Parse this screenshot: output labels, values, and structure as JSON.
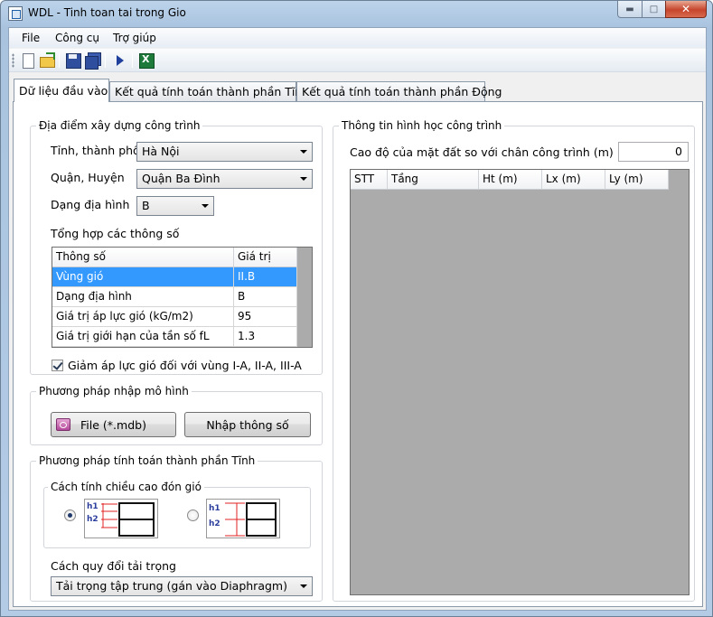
{
  "window": {
    "title": "WDL - Tinh toan tai trong Gio"
  },
  "menu": [
    {
      "label": "File"
    },
    {
      "label": "Công cụ"
    },
    {
      "label": "Trợ giúp"
    }
  ],
  "toolbar": {
    "icons": [
      "new-file-icon",
      "open-folder-icon",
      "save-icon",
      "save-all-icon",
      "run-icon",
      "excel-icon"
    ]
  },
  "tabs": [
    {
      "label": "Dữ liệu đầu vào",
      "active": true
    },
    {
      "label": "Kết quả tính toán thành phần Tĩnh"
    },
    {
      "label": "Kết quả tính toán thành phần Động"
    }
  ],
  "location": {
    "title": "Địa điểm xây dựng công trình",
    "province_label": "Tỉnh, thành phố",
    "province_value": "Hà Nội",
    "district_label": "Quận, Huyện",
    "district_value": "Quận Ba Đình",
    "terrain_label": "Dạng địa hình",
    "terrain_value": "B",
    "summary_title": "Tổng hợp các thông số",
    "params_table": {
      "headers": [
        "Thông số",
        "Giá trị"
      ],
      "rows": [
        [
          "Vùng gió",
          "II.B"
        ],
        [
          "Dạng địa hình",
          "B"
        ],
        [
          "Giá trị áp lực gió (kG/m2)",
          "95"
        ],
        [
          "Giá trị giới hạn của tần số fL",
          "1.3"
        ]
      ],
      "selected_row": 0
    },
    "reduce_checkbox_label": "Giảm áp lực gió đối với vùng I-A, II-A, III-A",
    "reduce_checked": true
  },
  "model_input": {
    "title": "Phương pháp nhập mô hình",
    "file_button": "File (*.mdb)",
    "params_button": "Nhập thông số"
  },
  "static_method": {
    "title": "Phương pháp tính toán thành phần Tĩnh",
    "height_group_title": "Cách tính chiều cao đón gió",
    "option_labels": [
      "h1",
      "h2"
    ],
    "selected_option": 0,
    "load_conversion_label": "Cách quy đổi tải trọng",
    "load_conversion_value": "Tải trọng tập trung (gán vào Diaphragm)"
  },
  "geometry": {
    "title": "Thông tin hình học công trình",
    "ground_label": "Cao độ của mặt đất so với chân công trình (m)",
    "ground_value": "0",
    "table_headers": [
      "STT",
      "Tầng",
      "Ht (m)",
      "Lx (m)",
      "Ly (m)"
    ]
  }
}
